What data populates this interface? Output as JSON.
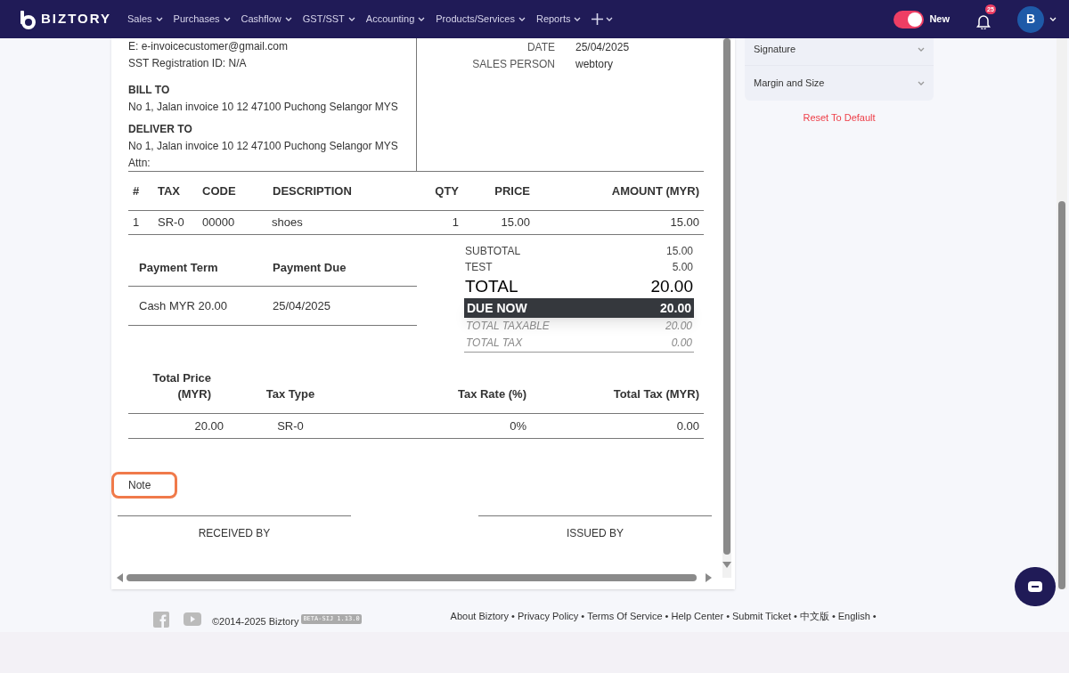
{
  "nav": {
    "logo": "BIZTORY",
    "menus": [
      "Sales",
      "Purchases",
      "Cashflow",
      "GST/SST",
      "Accounting",
      "Products/Services",
      "Reports"
    ],
    "toggle": {
      "label": "New",
      "on": true
    },
    "notification_count": "25",
    "avatar": "B"
  },
  "invoice": {
    "customer_lines": [
      "E: e-invoicecustomer@gmail.com",
      "SST Registration ID: N/A"
    ],
    "bill_to": {
      "heading": "BILL TO",
      "address": "No 1, Jalan invoice 10 12 47100 Puchong Selangor MYS"
    },
    "deliver_to": {
      "heading": "DELIVER TO",
      "address": "No 1, Jalan invoice 10 12 47100 Puchong Selangor MYS",
      "attn": "Attn:"
    },
    "meta": [
      {
        "label": "DATE",
        "value": "25/04/2025"
      },
      {
        "label": "SALES PERSON",
        "value": "webtory"
      }
    ],
    "items": {
      "columns": [
        "#",
        "TAX",
        "CODE",
        "DESCRIPTION",
        "QTY",
        "PRICE",
        "AMOUNT (MYR)"
      ],
      "rows": [
        [
          "1",
          "SR-0",
          "00000",
          "shoes",
          "1",
          "15.00",
          "15.00"
        ]
      ]
    },
    "payment": {
      "columns": [
        "Payment Term",
        "Payment Due"
      ],
      "rows": [
        [
          "Cash MYR 20.00",
          "25/04/2025"
        ]
      ]
    },
    "totals": [
      {
        "kind": "plain",
        "label": "SUBTOTAL",
        "value": "15.00"
      },
      {
        "kind": "plain",
        "label": "TEST",
        "value": "5.00"
      },
      {
        "kind": "big",
        "label": "TOTAL",
        "value": "20.00"
      },
      {
        "kind": "due",
        "label": "DUE NOW",
        "value": "20.00"
      },
      {
        "kind": "muted",
        "label": "TOTAL TAXABLE",
        "value": "20.00"
      },
      {
        "kind": "muted",
        "label": "TOTAL TAX",
        "value": "0.00"
      }
    ],
    "tax_summary": {
      "columns": [
        "Total Price (MYR)",
        "Tax Type",
        "Tax Rate (%)",
        "Total Tax (MYR)"
      ],
      "rows": [
        [
          "20.00",
          "SR-0",
          "0%",
          "0.00"
        ]
      ]
    },
    "note": "Note",
    "signatures": [
      "RECEIVED BY",
      "ISSUED BY"
    ]
  },
  "side_panel": {
    "sections": [
      {
        "label": "Signature",
        "expanded": false
      },
      {
        "label": "Margin and Size",
        "expanded": false
      }
    ],
    "reset": "Reset To Default"
  },
  "footer": {
    "copyright": "©2014-2025 Biztory",
    "version": "BETA-SIJ 1.13.0",
    "separator": "•",
    "links": [
      "About Biztory",
      "Privacy Policy",
      "Terms Of Service",
      "Help Center",
      "Submit Ticket",
      "中文版",
      "English"
    ]
  }
}
